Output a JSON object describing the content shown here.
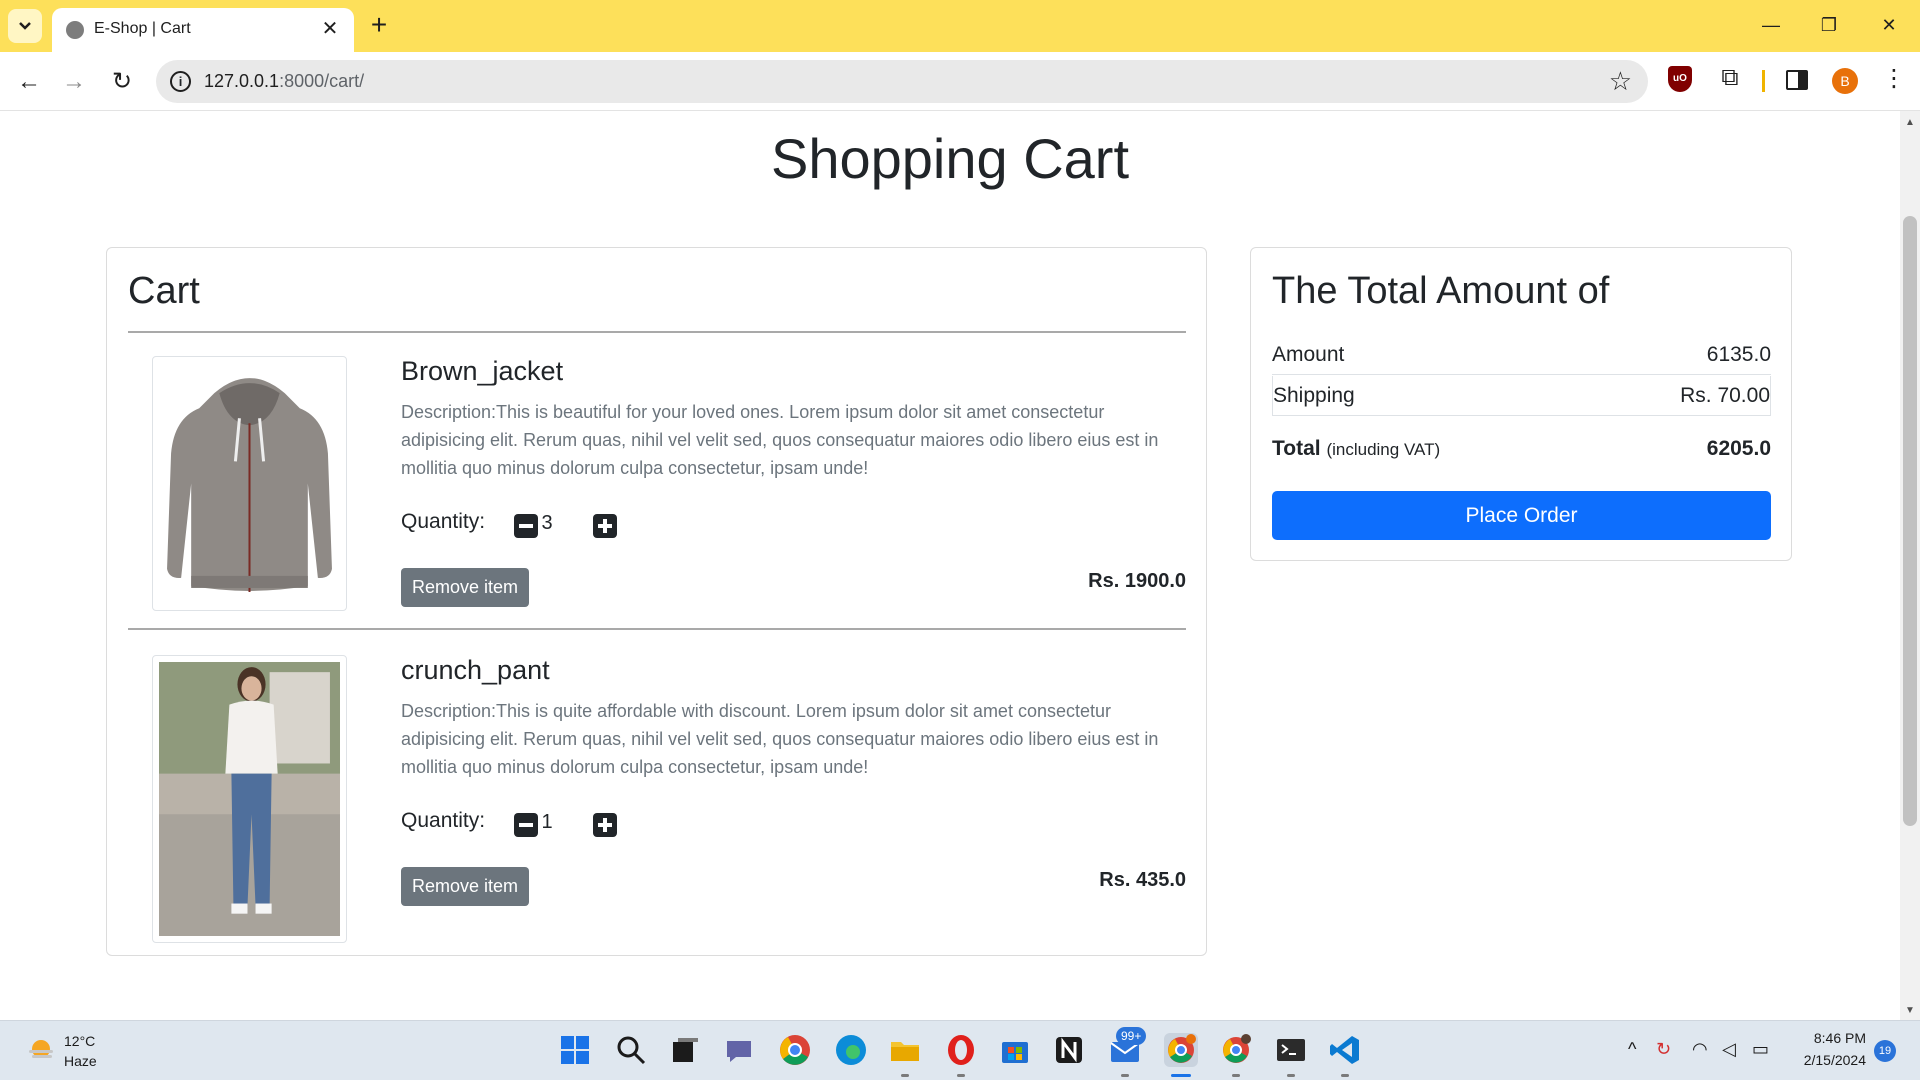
{
  "browser": {
    "tab_title": "E-Shop | Cart",
    "tab_close": "✕",
    "new_tab": "+",
    "url_host": "127.0.0.1",
    "url_path": ":8000/cart/",
    "profile_initial": "B",
    "ublock_label": "uO"
  },
  "page": {
    "heading": "Shopping Cart"
  },
  "cart": {
    "title": "Cart",
    "quantity_label": "Quantity:",
    "remove_label": "Remove item",
    "items": [
      {
        "name": "Brown_jacket",
        "description": "Description:This is beautiful for your loved ones. Lorem ipsum dolor sit amet consectetur adipisicing elit. Rerum quas, nihil vel velit sed, quos consequatur maiores odio libero eius est in mollitia quo minus dolorum culpa consectetur, ipsam unde!",
        "quantity": "3",
        "price": "Rs. 1900.0",
        "image": "hoodie-image"
      },
      {
        "name": "crunch_pant",
        "description": "Description:This is quite affordable with discount. Lorem ipsum dolor sit amet consectetur adipisicing elit. Rerum quas, nihil vel velit sed, quos consequatur maiores odio libero eius est in mollitia quo minus dolorum culpa consectetur, ipsam unde!",
        "quantity": "1",
        "price": "Rs. 435.0",
        "image": "model-jeans-image"
      }
    ]
  },
  "summary": {
    "title": "The Total Amount of",
    "amount_label": "Amount",
    "amount_value": "6135.0",
    "shipping_label": "Shipping",
    "shipping_value": "Rs. 70.00",
    "total_label": "Total",
    "total_note": "(including VAT)",
    "total_value": "6205.0",
    "button_label": "Place Order"
  },
  "taskbar": {
    "weather_temp": "12°C",
    "weather_condition": "Haze",
    "mail_badge": "99+",
    "chrome_badge": "B",
    "time": "8:46 PM",
    "date": "2/15/2024",
    "notification_count": "19"
  },
  "colors": {
    "tabbar": "#fde05a",
    "primary_button": "#0d6efd",
    "secondary_button": "#6c757d"
  }
}
